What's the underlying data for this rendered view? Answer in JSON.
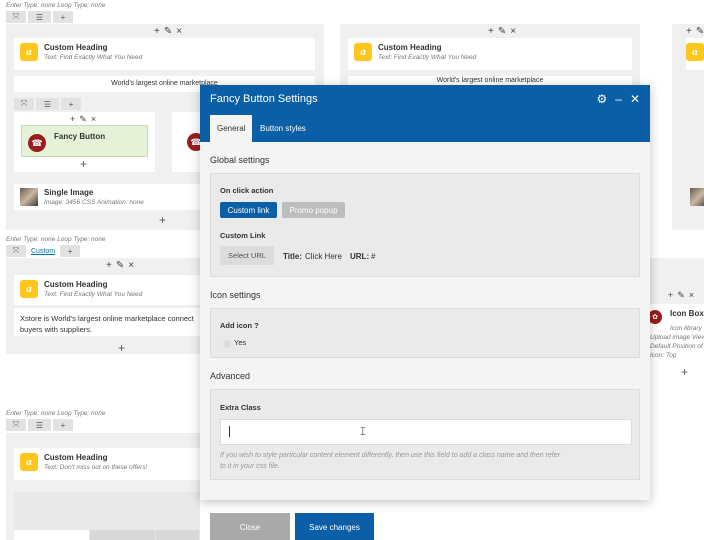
{
  "background": {
    "row_meta_1": "Enter Type: none  Loop Type: none",
    "row_meta_2": "Enter Type: none  Loop Type: none",
    "row_meta_3": "Enter Type: none  Loop Type: none",
    "custom_link_label": "Custom",
    "col_icons": {
      "add": "+",
      "edit": "✎",
      "delete": "×"
    },
    "custom_heading_title": "Custom Heading",
    "custom_heading_sub": "Text: Find Exactly What You Need",
    "custom_heading_sub_offers": "Text: Don't miss out on these offers!",
    "marketplace_text": "World's largest online marketplace",
    "fancy_button_title": "Fancy Button",
    "single_image_title": "Single Image",
    "single_image_sub": "Image: 3456  CSS Animation: none",
    "xstore_text_1": "Xstore is World's largest online marketplace connect",
    "xstore_text_2": "buyers with suppliers.",
    "icon_box_title": "Icon Box",
    "icon_box_lines": [
      "Icon library",
      "Upload image View",
      "Default  Position of",
      "Icon: Top"
    ],
    "logo_letter": "a",
    "plus": "+"
  },
  "modal": {
    "title": "Fancy Button Settings",
    "tabs": [
      {
        "label": "General",
        "active": true
      },
      {
        "label": "Button styles",
        "active": false
      }
    ],
    "global_settings": {
      "heading": "Global settings",
      "on_click_label": "On click action",
      "options": [
        "Custom link",
        "Promo popup"
      ],
      "selected": "Custom link",
      "custom_link_label": "Custom Link",
      "select_url_button": "Select URL",
      "title_label": "Title:",
      "title_value": "Click Here",
      "url_label": "URL:",
      "url_value": "#"
    },
    "icon_settings": {
      "heading": "Icon settings",
      "add_icon_label": "Add icon ?",
      "checkbox_label": "Yes"
    },
    "advanced": {
      "heading": "Advanced",
      "extra_class_label": "Extra Class",
      "extra_class_value": "",
      "help_line_1": "If you wish to style particular content element differently, then use this field to add a class name and then refer",
      "help_line_2": "to it in your css file."
    },
    "footer": {
      "close": "Close",
      "save": "Save changes"
    }
  },
  "colors": {
    "header_blue": "#0a5fa6",
    "accent_yellow": "#ffc61e",
    "icon_red": "#9b1c1c",
    "fancy_green": "#e6f2d7"
  }
}
